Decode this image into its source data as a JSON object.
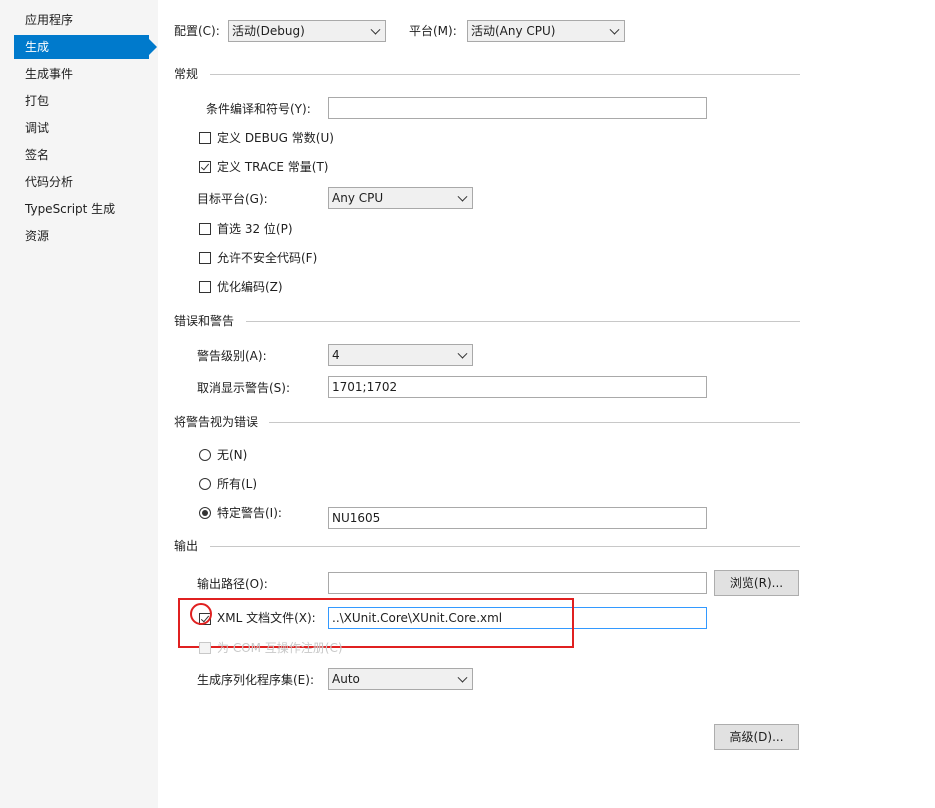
{
  "sidebar": {
    "items": [
      {
        "label": "应用程序"
      },
      {
        "label": "生成"
      },
      {
        "label": "生成事件"
      },
      {
        "label": "打包"
      },
      {
        "label": "调试"
      },
      {
        "label": "签名"
      },
      {
        "label": "代码分析"
      },
      {
        "label": "TypeScript 生成"
      },
      {
        "label": "资源"
      }
    ],
    "selected": "生成",
    "accent_color": "#007acc"
  },
  "top": {
    "config_label": "配置(C):",
    "config_value": "活动(Debug)",
    "platform_label": "平台(M):",
    "platform_value": "活动(Any CPU)"
  },
  "general": {
    "header": "常规",
    "cond_symbols_label": "条件编译和符号(Y):",
    "cond_symbols_value": "",
    "define_debug_label": "定义 DEBUG 常数(U)",
    "define_debug_checked": false,
    "define_trace_label": "定义 TRACE 常量(T)",
    "define_trace_checked": true,
    "target_platform_label": "目标平台(G):",
    "target_platform_value": "Any CPU",
    "prefer32_label": "首选 32 位(P)",
    "unsafe_label": "允许不安全代码(F)",
    "optimize_label": "优化编码(Z)"
  },
  "errors": {
    "header": "错误和警告",
    "warning_level_label": "警告级别(A):",
    "warning_level_value": "4",
    "suppress_label": "取消显示警告(S):",
    "suppress_value": "1701;1702"
  },
  "treat_as_errors": {
    "header": "将警告视为错误",
    "none_label": "无(N)",
    "all_label": "所有(L)",
    "specific_label": "特定警告(I):",
    "specific_value": "NU1605",
    "selected": "specific"
  },
  "output": {
    "header": "输出",
    "path_label": "输出路径(O):",
    "path_value": "",
    "browse_label": "浏览(R)...",
    "xml_doc_label": "XML 文档文件(X):",
    "xml_doc_checked": true,
    "xml_doc_value": "..\\XUnit.Core\\XUnit.Core.xml",
    "com_register_label": "为 COM 互操作注册(C)",
    "serialization_label": "生成序列化程序集(E):",
    "serialization_value": "Auto",
    "advanced_label": "高级(D)...",
    "highlight_color": "#e02020"
  }
}
